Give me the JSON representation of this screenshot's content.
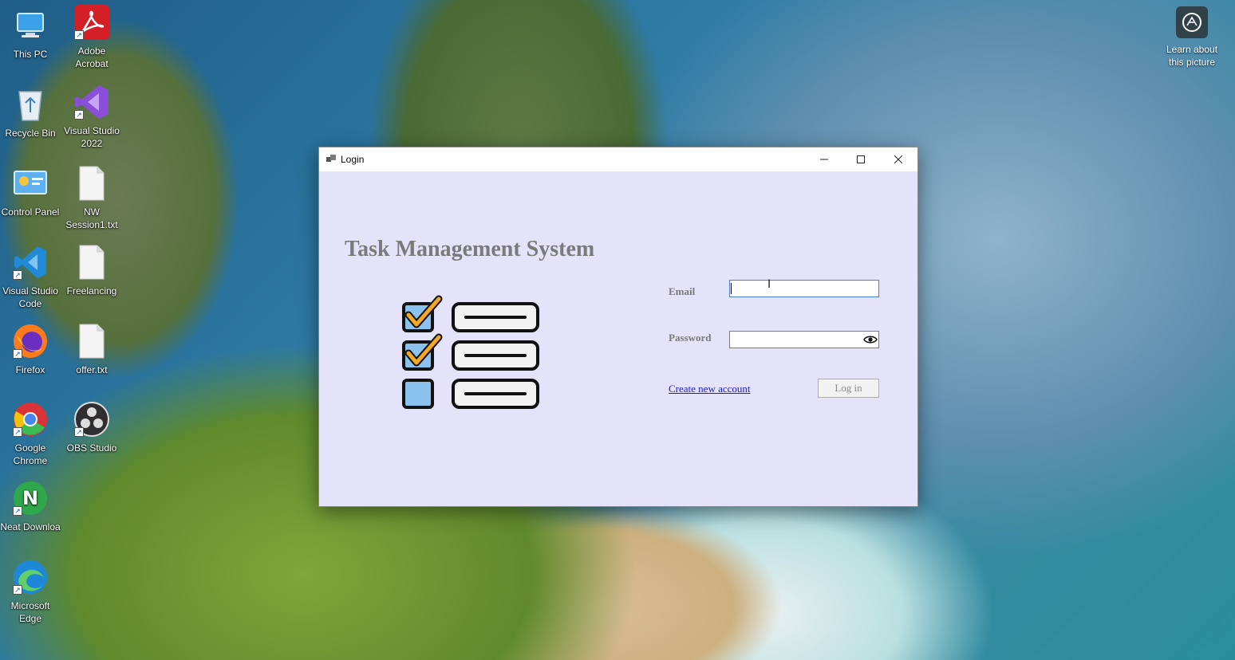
{
  "desktop": {
    "icons": [
      {
        "label": "This PC",
        "icon": "this-pc-icon"
      },
      {
        "label": "Adobe Acrobat",
        "icon": "adobe-acrobat-icon"
      },
      {
        "label": "Recycle Bin",
        "icon": "recycle-bin-icon"
      },
      {
        "label": "Visual Studio 2022",
        "icon": "visual-studio-icon"
      },
      {
        "label": "Control Panel",
        "icon": "control-panel-icon"
      },
      {
        "label": "NW Session1.txt",
        "icon": "text-file-icon"
      },
      {
        "label": "Visual Studio Code",
        "icon": "vscode-icon"
      },
      {
        "label": "Freelancing",
        "icon": "text-file-icon"
      },
      {
        "label": "Firefox",
        "icon": "firefox-icon"
      },
      {
        "label": "offer.txt",
        "icon": "text-file-icon"
      },
      {
        "label": "Google Chrome",
        "icon": "chrome-icon"
      },
      {
        "label": "OBS Studio",
        "icon": "obs-icon"
      },
      {
        "label": "Neat Downloa",
        "icon": "neat-download-icon"
      },
      {
        "label": "Microsoft Edge",
        "icon": "edge-icon"
      }
    ],
    "learn_picture": {
      "label": "Learn about this picture",
      "icon": "camera-icon"
    }
  },
  "window": {
    "title": "Login",
    "heading": "Task Management System",
    "email_label": "Email",
    "email_value": "",
    "password_label": "Password",
    "password_value": "",
    "create_account_link": "Create new account",
    "login_button": "Log in"
  },
  "colors": {
    "window_bg": "#e4e3fa",
    "heading": "#7a7a7a",
    "link": "#1a1ad6",
    "checkbox_fill": "#8cc3ee",
    "checkmark": "#f5a623"
  }
}
